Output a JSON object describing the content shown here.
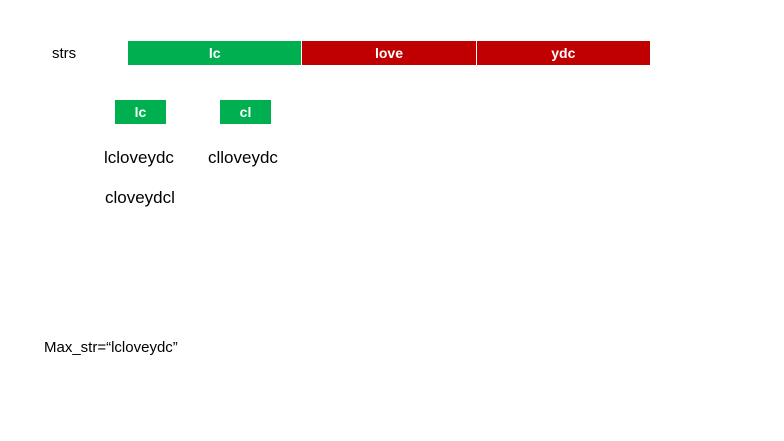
{
  "strs_label": "strs",
  "segments": [
    {
      "text": "lc",
      "color": "#00b050"
    },
    {
      "text": "love",
      "color": "#c00000"
    },
    {
      "text": "ydc",
      "color": "#c00000"
    }
  ],
  "chips": [
    {
      "text": "lc",
      "color": "#00b050"
    },
    {
      "text": "cl",
      "color": "#00b050"
    }
  ],
  "results": {
    "col1": [
      "lcloveydc",
      "cloveydcl"
    ],
    "col2": [
      "clloveydc"
    ]
  },
  "max_str_line": "Max_str=“lcloveydc”"
}
